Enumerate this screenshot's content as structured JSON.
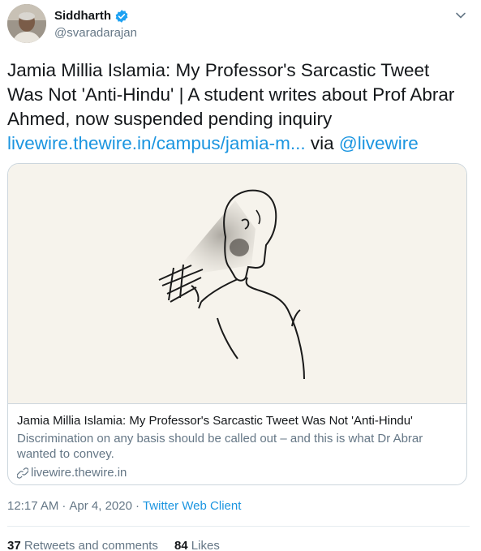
{
  "author": {
    "name": "Siddharth",
    "handle": "@svaradarajan"
  },
  "tweet": {
    "text": "Jamia Millia Islamia: My Professor's Sarcastic Tweet Was Not 'Anti-Hindu' | A student writes about Prof Abrar Ahmed, now suspended pending inquiry",
    "link_text": "livewire.thewire.in/campus/jamia-m...",
    "via_text": "via",
    "mention": "@livewire"
  },
  "card": {
    "title": "Jamia Millia Islamia: My Professor's Sarcastic Tweet Was Not 'Anti-Hindu'",
    "description": "Discrimination on any basis should be called out – and this is what Dr Abrar wanted to convey.",
    "domain": "livewire.thewire.in",
    "image_icon": "illustration-person-with-phone"
  },
  "meta": {
    "time": "12:17 AM",
    "separator": "·",
    "date": "Apr 4, 2020",
    "client": "Twitter Web Client"
  },
  "stats": {
    "retweets_count": "37",
    "retweets_label": "Retweets and comments",
    "likes_count": "84",
    "likes_label": "Likes"
  },
  "colors": {
    "link": "#1b95e0",
    "muted": "#657786",
    "border": "#ccd6dd",
    "verified": "#1da1f2"
  }
}
